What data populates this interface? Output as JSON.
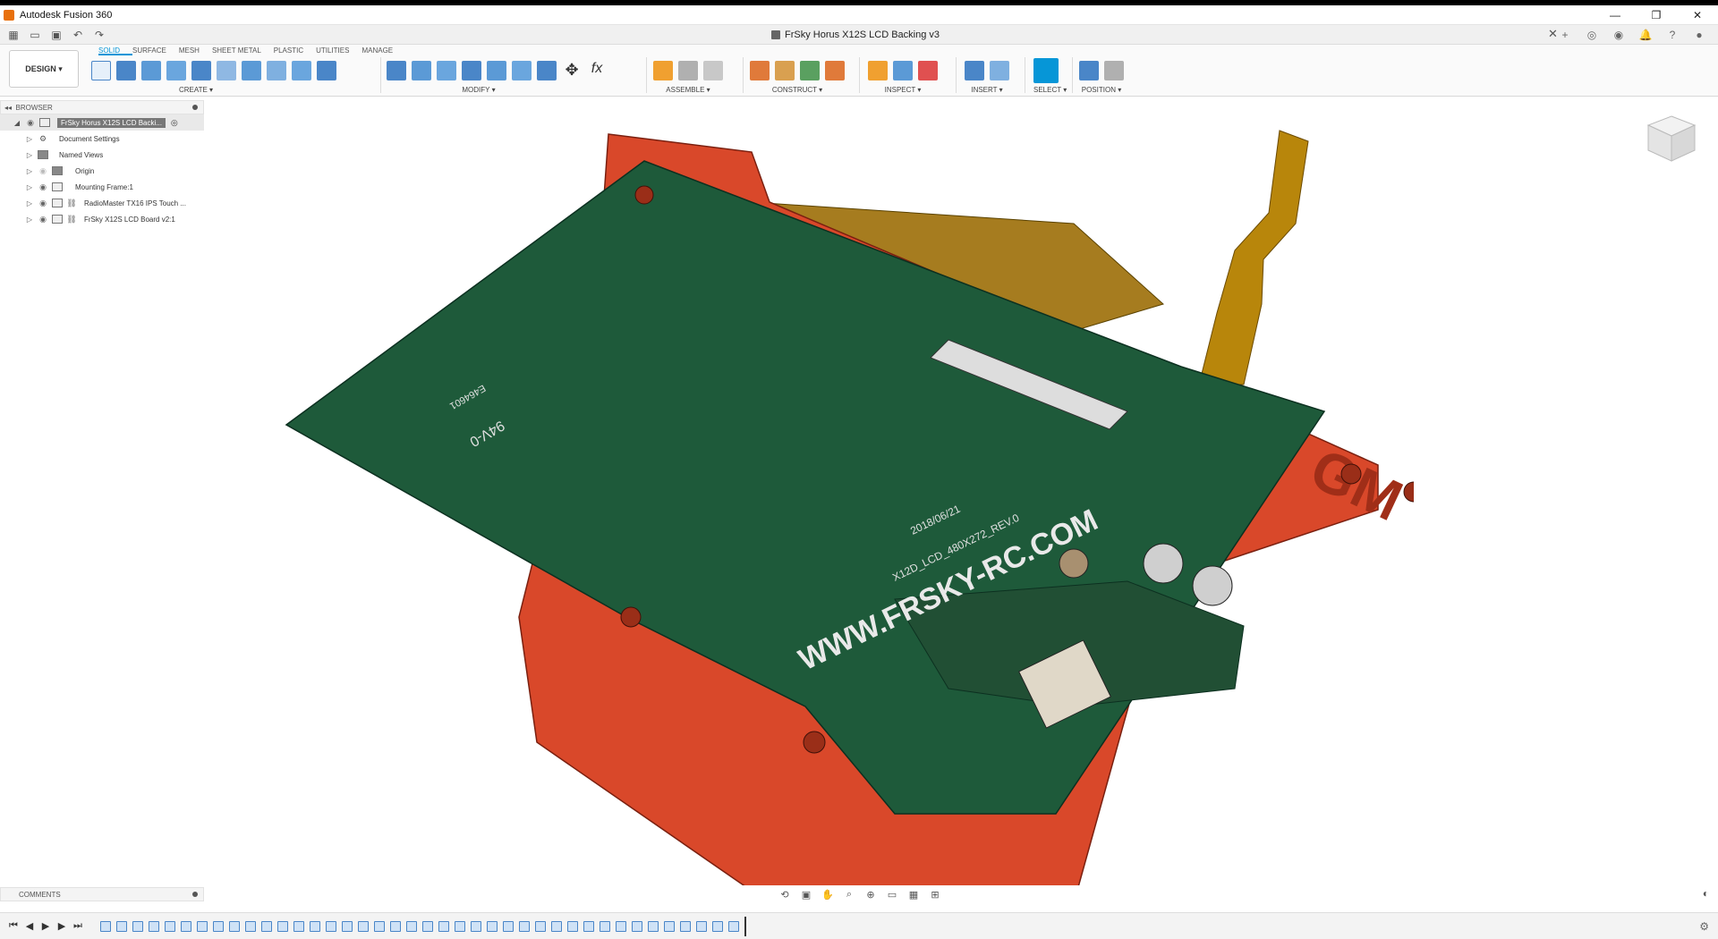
{
  "window": {
    "app_title": "Autodesk Fusion 360",
    "document_title": "FrSky Horus X12S LCD Backing v3"
  },
  "workspace": {
    "design_label": "DESIGN",
    "tabs": [
      "SOLID",
      "SURFACE",
      "MESH",
      "SHEET METAL",
      "PLASTIC",
      "UTILITIES",
      "MANAGE"
    ],
    "active_tab": "SOLID"
  },
  "groups": {
    "create": "CREATE",
    "modify": "MODIFY",
    "assemble": "ASSEMBLE",
    "construct": "CONSTRUCT",
    "inspect": "INSPECT",
    "insert": "INSERT",
    "select": "SELECT",
    "position": "POSITION"
  },
  "browser": {
    "title": "BROWSER",
    "root": "FrSky Horus X12S LCD Backi...",
    "items": [
      {
        "label": "Document Settings",
        "icon": "gear-icon"
      },
      {
        "label": "Named Views",
        "icon": "folder-icon"
      },
      {
        "label": "Origin",
        "icon": "folder-icon"
      },
      {
        "label": "Mounting Frame:1",
        "icon": "component-icon"
      },
      {
        "label": "RadioMaster TX16 IPS Touch ...",
        "icon": "linked-component-icon"
      },
      {
        "label": "FrSky X12S LCD Board v2:1",
        "icon": "linked-component-icon"
      }
    ]
  },
  "comments": {
    "title": "COMMENTS"
  },
  "model_text": {
    "url": "WWW.FRSKY-RC.COM",
    "board": "X12D_LCD_480X272_REV.0",
    "date": "2018/06/21",
    "cert": "94V-0",
    "serial": "E464601",
    "logo": "GM"
  },
  "colors": {
    "accent": "#0696d7",
    "frame": "#d9482a",
    "pcb": "#1e5a3a",
    "flex": "#b8860b"
  }
}
